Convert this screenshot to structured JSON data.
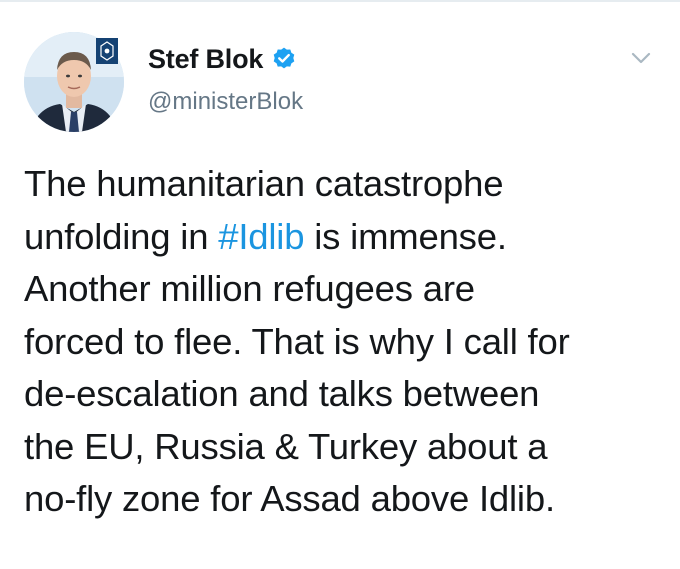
{
  "author": {
    "display_name": "Stef Blok",
    "handle": "@ministerBlok",
    "verified": true
  },
  "tweet": {
    "line1": "The humanitarian catastrophe",
    "line2_pre": "unfolding in ",
    "line2_hashtag": "#Idlib",
    "line2_post": " is immense.",
    "line3": "Another million refugees are",
    "line4": "forced to flee. That is why I call for",
    "line5": "de-escalation and talks between",
    "line6": "the EU, Russia & Turkey about a",
    "line7": "no-fly zone for Assad above Idlib."
  },
  "colors": {
    "link": "#1b95e0",
    "text": "#14171a",
    "secondary": "#657786",
    "verified": "#1da1f2"
  },
  "icons": {
    "verified": "verified-badge-icon",
    "menu": "chevron-down-icon"
  }
}
